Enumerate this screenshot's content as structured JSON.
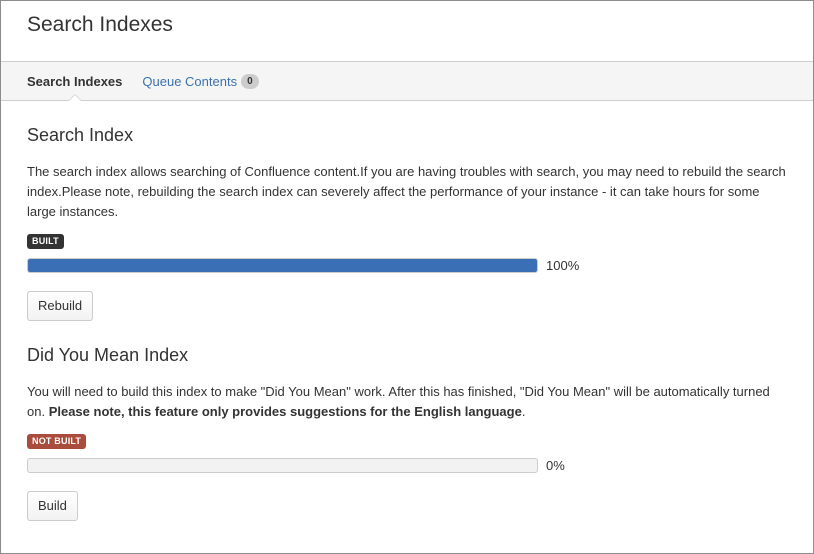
{
  "page": {
    "title": "Search Indexes"
  },
  "tabs": [
    {
      "label": "Search Indexes",
      "active": true
    },
    {
      "label": "Queue Contents",
      "badge": "0",
      "active": false
    }
  ],
  "sections": [
    {
      "title": "Search Index",
      "description": "The search index allows searching of Confluence content.If you are having troubles with search, you may need to rebuild the search index.Please note, rebuilding the search index can severely affect the performance of your instance - it can take hours for some large instances.",
      "status": "BUILT",
      "status_color": "#333333",
      "progress": 100,
      "progress_label": "100%",
      "button_label": "Rebuild"
    },
    {
      "title": "Did You Mean Index",
      "description": "You will need to build this index to make \"Did You Mean\" work. After this has finished, \"Did You Mean\" will be automatically turned on. ",
      "description_bold": "Please note, this feature only provides suggestions for the English language",
      "description_tail": ".",
      "status": "NOT BUILT",
      "status_color": "#a94c3b",
      "progress": 0,
      "progress_label": "0%",
      "button_label": "Build"
    }
  ],
  "colors": {
    "link": "#3b73af",
    "progress_fill": "#3a6fb6"
  }
}
